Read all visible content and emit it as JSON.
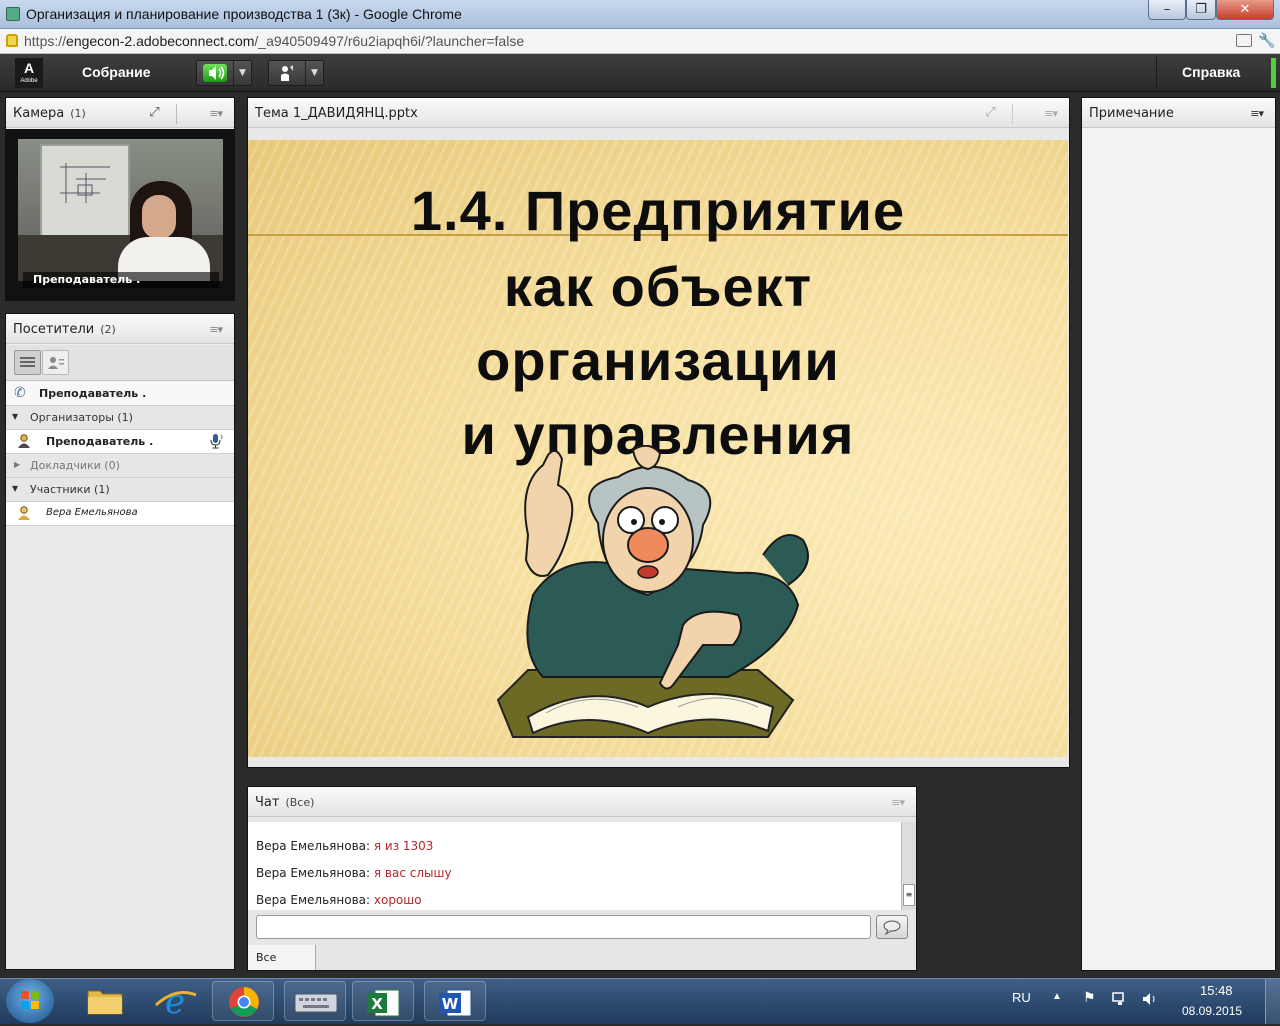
{
  "browser": {
    "window_title": "Организация и планирование производства 1 (3к) - Google Chrome",
    "url_prefix": "https://",
    "url_host": "engecon-2.adobeconnect.com",
    "url_path": "/_a940509497/r6u2iapqh6i/?launcher=false",
    "minimize": "–",
    "maximize": "❐",
    "close": "✕"
  },
  "toolbar": {
    "logo": "A",
    "logo_sub": "Adobe",
    "meeting_menu": "Собрание",
    "help_menu": "Справка",
    "speaker_color": "#4fd13a"
  },
  "camera_pod": {
    "title": "Камера",
    "count": "(1)",
    "video_label": "Преподаватель ."
  },
  "attendees_pod": {
    "title": "Посетители",
    "count": "(2)",
    "phone_user": "Преподаватель .",
    "groups": [
      {
        "label": "Организаторы (1)",
        "expanded": true
      },
      {
        "label": "Докладчики (0)",
        "expanded": false
      },
      {
        "label": "Участники (1)",
        "expanded": true
      }
    ],
    "host_user": "Преподаватель .",
    "participant_user": "Вера Емельянова"
  },
  "share_pod": {
    "title": "Тема 1_ДАВИДЯНЦ.pptx",
    "slide_lines": [
      "1.4. Предприятие",
      "как объект",
      "организации",
      "и управления"
    ]
  },
  "notes_pod": {
    "title": "Примечание"
  },
  "chat_pod": {
    "title": "Чат",
    "scope": "(Все)",
    "messages": [
      {
        "sender": "Вера Емельянова:",
        "text": "я из 1303"
      },
      {
        "sender": "Вера Емельянова:",
        "text": "я вас слышу"
      },
      {
        "sender": "Вера Емельянова:",
        "text": "хорошо"
      }
    ],
    "input_value": "",
    "tab_all": "Все"
  },
  "taskbar": {
    "apps": [
      "start-orb",
      "file-explorer",
      "internet-explorer",
      "chrome",
      "keyboard",
      "excel",
      "word"
    ],
    "language": "RU",
    "time": "15:48",
    "date": "08.09.2015"
  }
}
